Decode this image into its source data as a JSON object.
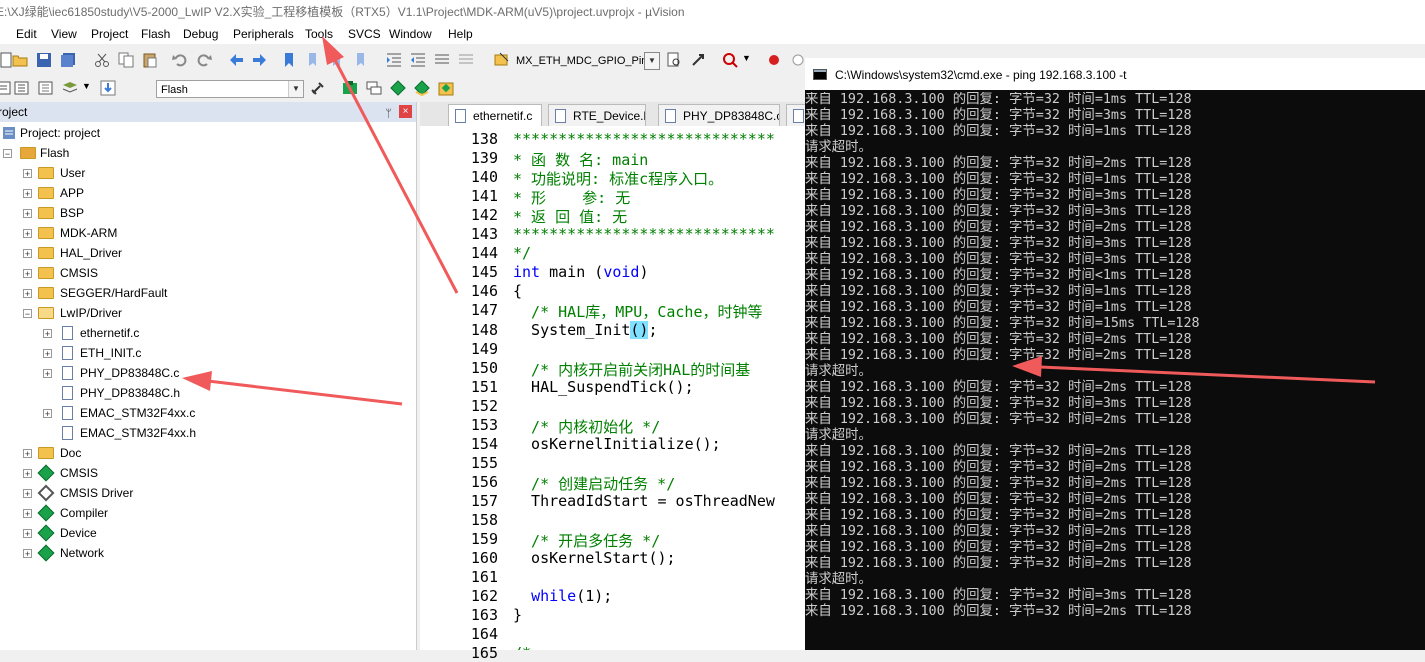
{
  "window_title": "E:\\XJ绿能\\iec61850study\\V5-2000_LwIP V2.X实验_工程移植模板（RTX5）V1.1\\Project\\MDK-ARM(uV5)\\project.uvprojx - µVision",
  "menu": [
    "Edit",
    "View",
    "Project",
    "Flash",
    "Debug",
    "Peripherals",
    "Tools",
    "SVCS",
    "Window",
    "Help"
  ],
  "toolbar": {
    "target_combo": "MX_ETH_MDC_GPIO_Pin",
    "build_target": "Flash"
  },
  "project_panel": {
    "title": "roject",
    "pin": "ᛘ",
    "close": "×",
    "root": "Project: project",
    "target": "Flash",
    "groups": [
      "User",
      "APP",
      "BSP",
      "MDK-ARM",
      "HAL_Driver",
      "CMSIS",
      "SEGGER/HardFault",
      "LwIP/Driver"
    ],
    "lwip_files": [
      "ethernetif.c",
      "ETH_INIT.c",
      "PHY_DP83848C.c",
      "PHY_DP83848C.h",
      "EMAC_STM32F4xx.c",
      "EMAC_STM32F4xx.h"
    ],
    "other_groups": [
      "Doc",
      "CMSIS",
      "CMSIS Driver",
      "Compiler",
      "Device",
      "Network"
    ]
  },
  "editor": {
    "tabs": [
      "ethernetif.c",
      "RTE_Device.h",
      "PHY_DP83848C.c",
      ""
    ],
    "lines": [
      {
        "num": "138",
        "text": "*****************************"
      },
      {
        "num": "139",
        "text": "* 函 数 名: main"
      },
      {
        "num": "140",
        "text": "* 功能说明: 标准c程序入口。"
      },
      {
        "num": "141",
        "text": "* 形    参: 无"
      },
      {
        "num": "142",
        "text": "* 返 回 值: 无"
      },
      {
        "num": "143",
        "text": "*****************************"
      },
      {
        "num": "144",
        "text": "*/"
      },
      {
        "num": "145",
        "text": "int main (void)"
      },
      {
        "num": "146",
        "text": "{"
      },
      {
        "num": "147",
        "text": "  /* HAL库，MPU，Cache，时钟等"
      },
      {
        "num": "148",
        "text": "  System_Init();"
      },
      {
        "num": "149",
        "text": ""
      },
      {
        "num": "150",
        "text": "  /* 内核开启前关闭HAL的时间基"
      },
      {
        "num": "151",
        "text": "  HAL_SuspendTick();"
      },
      {
        "num": "152",
        "text": ""
      },
      {
        "num": "153",
        "text": "  /* 内核初始化 */"
      },
      {
        "num": "154",
        "text": "  osKernelInitialize();"
      },
      {
        "num": "155",
        "text": ""
      },
      {
        "num": "156",
        "text": "  /* 创建启动任务 */"
      },
      {
        "num": "157",
        "text": "  ThreadIdStart = osThreadNew"
      },
      {
        "num": "158",
        "text": ""
      },
      {
        "num": "159",
        "text": "  /* 开启多任务 */"
      },
      {
        "num": "160",
        "text": "  osKernelStart();"
      },
      {
        "num": "161",
        "text": ""
      },
      {
        "num": "162",
        "text": "  while(1);"
      },
      {
        "num": "163",
        "text": "}"
      },
      {
        "num": "164",
        "text": ""
      },
      {
        "num": "165",
        "text": "/*"
      }
    ]
  },
  "cmd": {
    "title": "C:\\Windows\\system32\\cmd.exe - ping  192.168.3.100 -t",
    "lines": [
      "来自 192.168.3.100 的回复: 字节=32 时间=1ms TTL=128",
      "来自 192.168.3.100 的回复: 字节=32 时间=3ms TTL=128",
      "来自 192.168.3.100 的回复: 字节=32 时间=1ms TTL=128",
      "请求超时。",
      "来自 192.168.3.100 的回复: 字节=32 时间=2ms TTL=128",
      "来自 192.168.3.100 的回复: 字节=32 时间=1ms TTL=128",
      "来自 192.168.3.100 的回复: 字节=32 时间=3ms TTL=128",
      "来自 192.168.3.100 的回复: 字节=32 时间=3ms TTL=128",
      "来自 192.168.3.100 的回复: 字节=32 时间=2ms TTL=128",
      "来自 192.168.3.100 的回复: 字节=32 时间=3ms TTL=128",
      "来自 192.168.3.100 的回复: 字节=32 时间=3ms TTL=128",
      "来自 192.168.3.100 的回复: 字节=32 时间<1ms TTL=128",
      "来自 192.168.3.100 的回复: 字节=32 时间=1ms TTL=128",
      "来自 192.168.3.100 的回复: 字节=32 时间=1ms TTL=128",
      "来自 192.168.3.100 的回复: 字节=32 时间=15ms TTL=128",
      "来自 192.168.3.100 的回复: 字节=32 时间=2ms TTL=128",
      "来自 192.168.3.100 的回复: 字节=32 时间=2ms TTL=128",
      "请求超时。",
      "来自 192.168.3.100 的回复: 字节=32 时间=2ms TTL=128",
      "来自 192.168.3.100 的回复: 字节=32 时间=3ms TTL=128",
      "来自 192.168.3.100 的回复: 字节=32 时间=2ms TTL=128",
      "请求超时。",
      "来自 192.168.3.100 的回复: 字节=32 时间=2ms TTL=128",
      "来自 192.168.3.100 的回复: 字节=32 时间=2ms TTL=128",
      "来自 192.168.3.100 的回复: 字节=32 时间=2ms TTL=128",
      "来自 192.168.3.100 的回复: 字节=32 时间=2ms TTL=128",
      "来自 192.168.3.100 的回复: 字节=32 时间=2ms TTL=128",
      "来自 192.168.3.100 的回复: 字节=32 时间=2ms TTL=128",
      "来自 192.168.3.100 的回复: 字节=32 时间=2ms TTL=128",
      "来自 192.168.3.100 的回复: 字节=32 时间=2ms TTL=128",
      "请求超时。",
      "来自 192.168.3.100 的回复: 字节=32 时间=3ms TTL=128",
      "来自 192.168.3.100 的回复: 字节=32 时间=2ms TTL=128"
    ]
  },
  "colors": {
    "annotation_arrow": "#f05a5a",
    "code_comment": "#008000",
    "code_keyword": "#0000ff",
    "cmd_bg": "#0c0c0c",
    "cmd_text": "#cccccc"
  }
}
